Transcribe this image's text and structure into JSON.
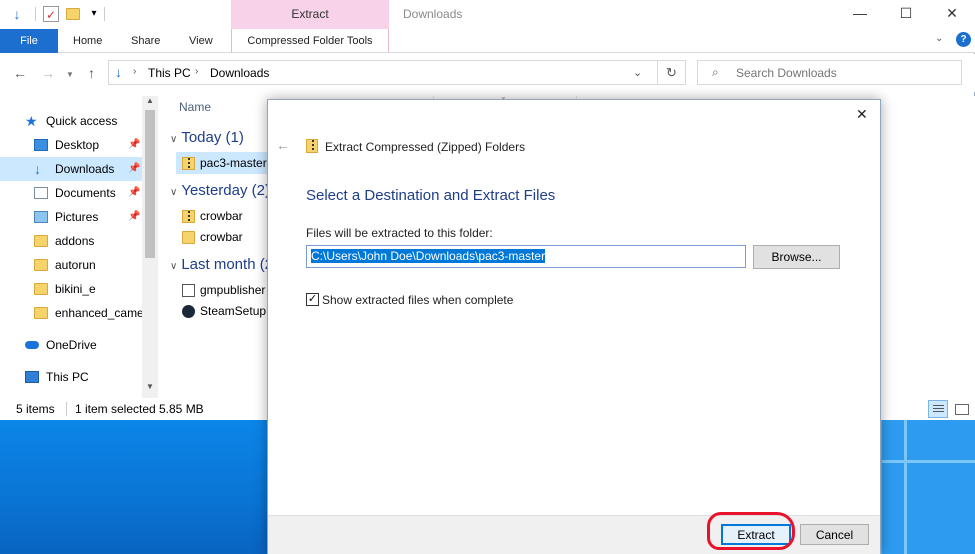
{
  "window": {
    "context_tab_header": "Extract",
    "title": "Downloads",
    "min_glyph": "—",
    "max_glyph": "☐",
    "close_glyph": "✕"
  },
  "ribbon": {
    "file": "File",
    "home": "Home",
    "share": "Share",
    "view": "View",
    "compressed": "Compressed Folder Tools",
    "expand_glyph": "⌄",
    "help_glyph": "?"
  },
  "address": {
    "crumbs": [
      "This PC",
      "Downloads"
    ],
    "search_placeholder": "Search Downloads"
  },
  "navpane": {
    "items": [
      {
        "label": "Quick access",
        "icon": "star-icon",
        "pinned": false
      },
      {
        "label": "Desktop",
        "icon": "desktop-icon",
        "pinned": true
      },
      {
        "label": "Downloads",
        "icon": "download-icon",
        "pinned": true
      },
      {
        "label": "Documents",
        "icon": "document-icon",
        "pinned": true
      },
      {
        "label": "Pictures",
        "icon": "pictures-icon",
        "pinned": true
      },
      {
        "label": "addons",
        "icon": "folder-icon",
        "pinned": false
      },
      {
        "label": "autorun",
        "icon": "folder-icon",
        "pinned": false
      },
      {
        "label": "bikini_e",
        "icon": "folder-icon",
        "pinned": false
      },
      {
        "label": "enhanced_came",
        "icon": "folder-icon",
        "pinned": false
      },
      {
        "label": "OneDrive",
        "icon": "onedrive-icon",
        "pinned": false
      },
      {
        "label": "This PC",
        "icon": "this-pc-icon",
        "pinned": false
      }
    ]
  },
  "filepane": {
    "column_name": "Name",
    "groups": [
      "Today (1)",
      "Yesterday (2)",
      "Last month (2"
    ],
    "files": [
      "pac3-master",
      "crowbar",
      "crowbar",
      "gmpublisher",
      "SteamSetup"
    ]
  },
  "status": {
    "items": "5 items",
    "selected": "1 item selected",
    "size": "5.85 MB"
  },
  "dialog": {
    "caption": "Extract Compressed (Zipped) Folders",
    "heading": "Select a Destination and Extract Files",
    "label": "Files will be extracted to this folder:",
    "path": "C:\\Users\\John Doe\\Downloads\\pac3-master",
    "browse": "Browse...",
    "show_files_label": "Show extracted files when complete",
    "show_files_checked": true,
    "extract": "Extract",
    "cancel": "Cancel"
  },
  "colors": {
    "file_tab": "#1d6fcf",
    "context_tab": "#f7d2e8",
    "selection": "#cce8ff",
    "heading_blue": "#1e3d8a",
    "annotation_red": "#e8132a"
  }
}
